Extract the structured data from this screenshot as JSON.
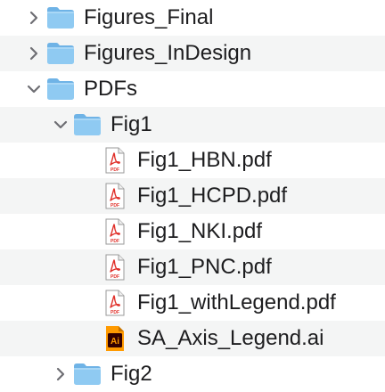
{
  "items": [
    {
      "label": "Figures_Final",
      "type": "folder",
      "expanded": false,
      "icon": "folder-icon",
      "chevron": "chevron-right-icon"
    },
    {
      "label": "Figures_InDesign",
      "type": "folder",
      "expanded": false,
      "icon": "folder-icon",
      "chevron": "chevron-right-icon"
    },
    {
      "label": "PDFs",
      "type": "folder",
      "expanded": true,
      "icon": "folder-icon",
      "chevron": "chevron-down-icon"
    },
    {
      "label": "Fig1",
      "type": "folder",
      "expanded": true,
      "icon": "folder-icon",
      "chevron": "chevron-down-icon"
    },
    {
      "label": "Fig1_HBN.pdf",
      "type": "file",
      "icon": "pdf-file-icon"
    },
    {
      "label": "Fig1_HCPD.pdf",
      "type": "file",
      "icon": "pdf-file-icon"
    },
    {
      "label": "Fig1_NKI.pdf",
      "type": "file",
      "icon": "pdf-file-icon"
    },
    {
      "label": "Fig1_PNC.pdf",
      "type": "file",
      "icon": "pdf-file-icon"
    },
    {
      "label": "Fig1_withLegend.pdf",
      "type": "file",
      "icon": "pdf-file-icon"
    },
    {
      "label": "SA_Axis_Legend.ai",
      "type": "file",
      "icon": "illustrator-file-icon"
    },
    {
      "label": "Fig2",
      "type": "folder",
      "expanded": false,
      "icon": "folder-icon",
      "chevron": "chevron-right-icon"
    }
  ],
  "colors": {
    "folder_body": "#8fcaf2",
    "folder_tab": "#6fb3e6",
    "pdf_red": "#e0312b",
    "ai_orange": "#ff9a00",
    "ai_bg": "#330000",
    "row_alt": "#f4f5f5",
    "chevron": "#6e6e73"
  }
}
